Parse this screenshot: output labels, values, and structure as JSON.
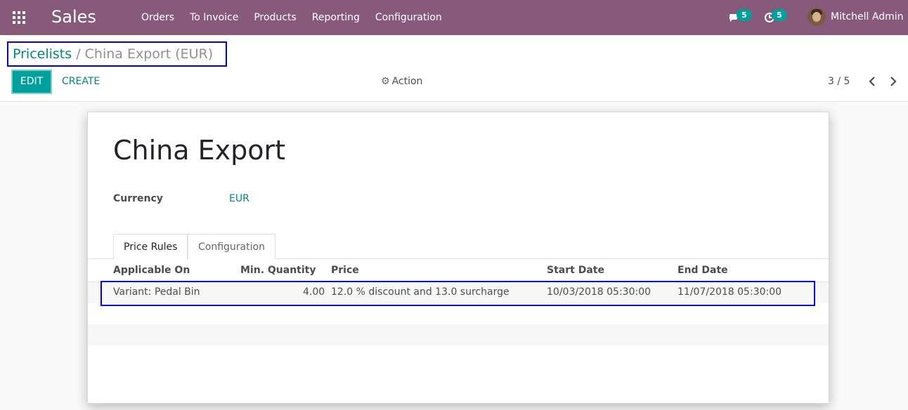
{
  "navbar": {
    "app_name": "Sales",
    "menu": [
      "Orders",
      "To Invoice",
      "Products",
      "Reporting",
      "Configuration"
    ],
    "messages_count": "5",
    "activities_count": "5",
    "user_name": "Mitchell Admin",
    "icons": [
      "apps-grid-icon",
      "chat-bubbles-icon",
      "clock-icon",
      "user-avatar"
    ],
    "colors": {
      "navbar_bg": "#875a7b",
      "accent": "#00a09d",
      "link": "#00877d"
    }
  },
  "control_panel": {
    "breadcrumb_parent": "Pricelists",
    "breadcrumb_separator": "/",
    "breadcrumb_current": "China Export (EUR)",
    "edit_label": "EDIT",
    "create_label": "CREATE",
    "action_label": "Action",
    "pager": "3 / 5"
  },
  "form": {
    "title": "China Export",
    "currency_label": "Currency",
    "currency_value": "EUR",
    "tabs": [
      "Price Rules",
      "Configuration"
    ],
    "columns": [
      "Applicable On",
      "Min. Quantity",
      "Price",
      "Start Date",
      "End Date"
    ],
    "rows": [
      {
        "applicable_on": "Variant: Pedal Bin",
        "min_quantity": "4.00",
        "price": "12.0 % discount and 13.0 surcharge",
        "start_date": "10/03/2018 05:30:00",
        "end_date": "11/07/2018 05:30:00"
      }
    ]
  }
}
